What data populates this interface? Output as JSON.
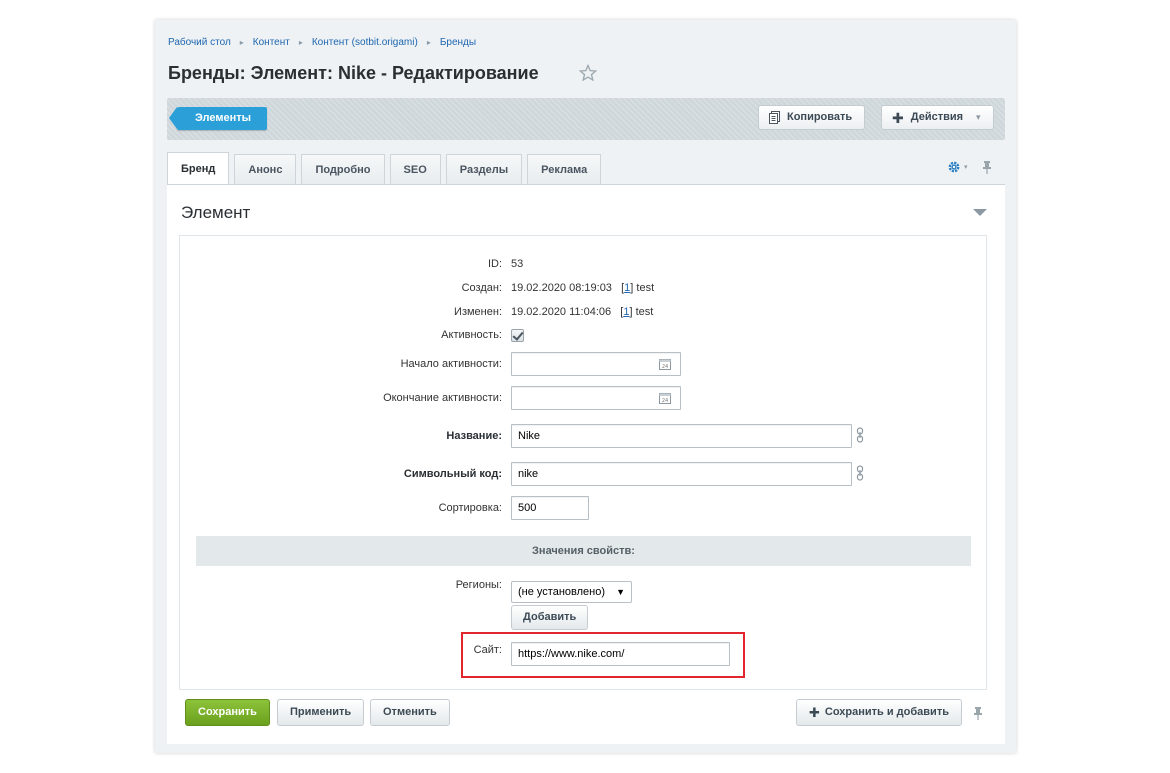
{
  "breadcrumbs": [
    "Рабочий стол",
    "Контент",
    "Контент (sotbit.origami)",
    "Бренды"
  ],
  "page_title": "Бренды: Элемент: Nike - Редактирование",
  "toolbar": {
    "elements_label": "Элементы",
    "copy_label": "Копировать",
    "actions_label": "Действия"
  },
  "tabs": [
    "Бренд",
    "Анонс",
    "Подробно",
    "SEO",
    "Разделы",
    "Реклама"
  ],
  "section_title": "Элемент",
  "fields": {
    "id_label": "ID:",
    "id_value": "53",
    "created_label": "Создан:",
    "created_value": "19.02.2020 08:19:03",
    "created_user_id": "1",
    "created_user": "test",
    "modified_label": "Изменен:",
    "modified_value": "19.02.2020 11:04:06",
    "modified_user_id": "1",
    "modified_user": "test",
    "active_label": "Активность:",
    "active_from_label": "Начало активности:",
    "active_from_value": "",
    "active_to_label": "Окончание активности:",
    "active_to_value": "",
    "name_label": "Название:",
    "name_value": "Nike",
    "code_label": "Символьный код:",
    "code_value": "nike",
    "sort_label": "Сортировка:",
    "sort_value": "500"
  },
  "properties": {
    "header": "Значения свойств:",
    "regions_label": "Регионы:",
    "regions_value": "(не установлено)",
    "add_label": "Добавить",
    "site_label": "Сайт:",
    "site_value": "https://www.nike.com/"
  },
  "footer": {
    "save_label": "Сохранить",
    "apply_label": "Применить",
    "cancel_label": "Отменить",
    "save_add_label": "Сохранить и добавить"
  },
  "colors": {
    "accent_blue": "#2b9fd8",
    "save_green": "#7ab22c",
    "highlight_red": "#e3262d",
    "link": "#2067b0"
  }
}
